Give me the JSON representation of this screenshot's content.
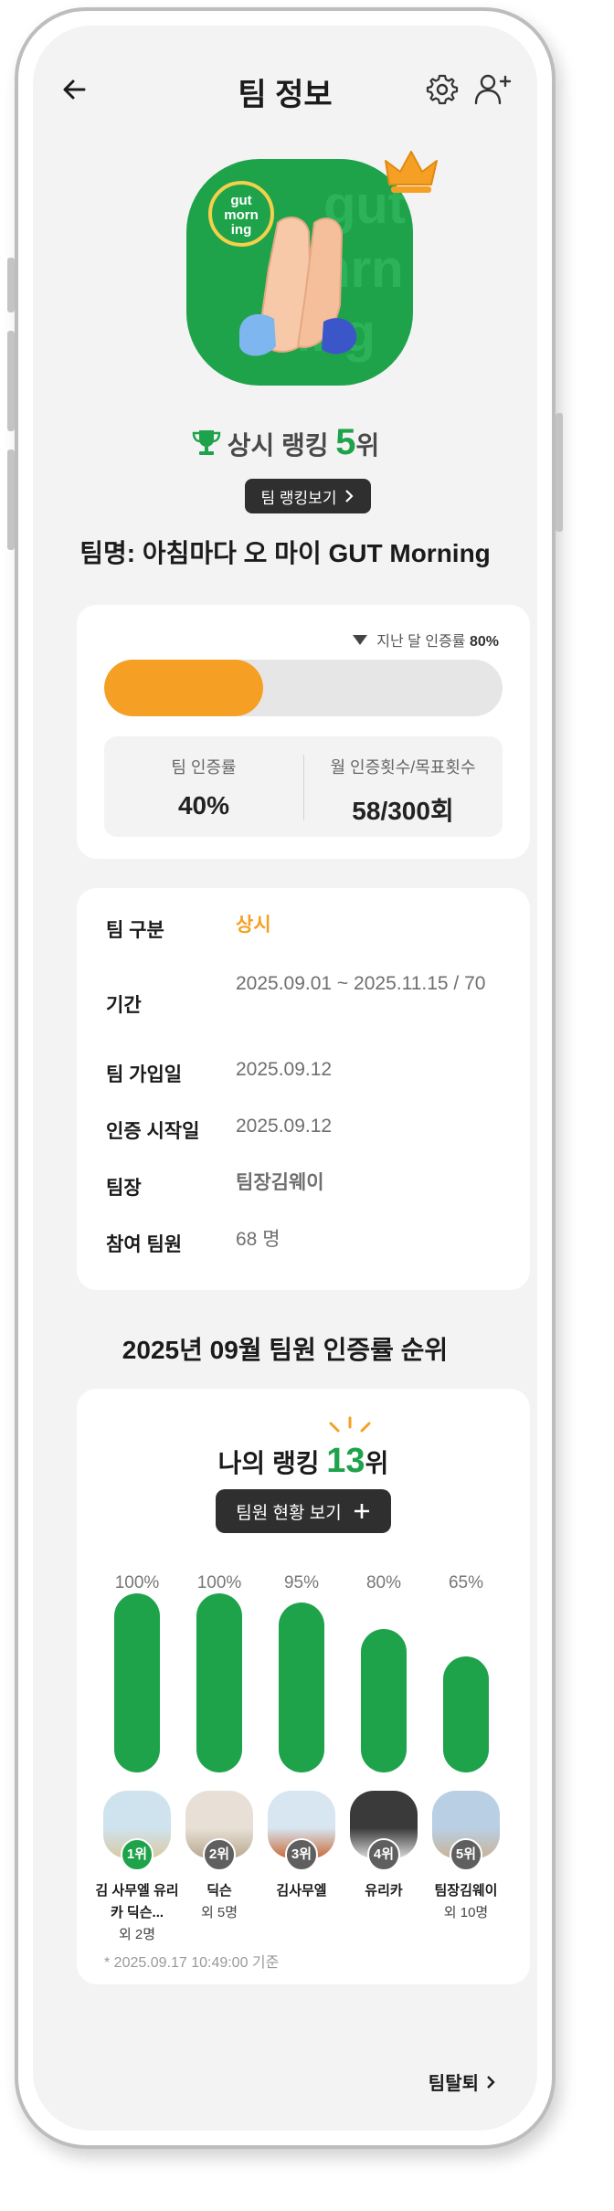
{
  "header": {
    "title": "팀 정보",
    "back_icon": "back-arrow-icon",
    "settings_icon": "gear-icon",
    "add_member_icon": "add-user-icon"
  },
  "team": {
    "logo_text": "gut morn ing",
    "ranking_prefix": "상시 랭킹",
    "ranking_value": "5",
    "ranking_suffix": "위",
    "ranking_button": "팀 랭킹보기",
    "name": "팀명: 아침마다 오 마이 GUT Morning"
  },
  "progress": {
    "last_month_label": "지난 달 인증률",
    "last_month_value": "80%",
    "fill_fraction": 0.4,
    "rate_label": "팀 인증률",
    "rate_value": "40%",
    "count_label": "월 인증횟수/목표횟수",
    "count_value": "58/300회"
  },
  "info": {
    "rows": [
      {
        "key": "팀 구분",
        "value": "상시"
      },
      {
        "key": "기간",
        "value": "2025.09.01 ~ 2025.11.15 / 70"
      },
      {
        "key": "팀 가입일",
        "value": "2025.09.12"
      },
      {
        "key": "인증 시작일",
        "value": "2025.09.12"
      },
      {
        "key": "팀장",
        "value": "팀장김웨이"
      },
      {
        "key": "참여 팀원",
        "value": "68 명"
      }
    ]
  },
  "ranking_section": {
    "title": "2025년 09월 팀원 인증률 순위",
    "my_rank_prefix": "나의 랭킹",
    "my_rank_value": "13",
    "my_rank_suffix": "위",
    "member_button": "팀원 현황 보기",
    "timestamp": "* 2025.09.17 10:49:00 기준"
  },
  "chart_data": {
    "type": "bar",
    "categories": [
      "1위",
      "2위",
      "3위",
      "4위",
      "5위"
    ],
    "values": [
      100,
      100,
      95,
      80,
      65
    ],
    "value_labels": [
      "100%",
      "100%",
      "95%",
      "80%",
      "65%"
    ],
    "ylim": [
      0,
      100
    ],
    "members": [
      {
        "rank": "1위",
        "name": "김 사무엘 유리카 딕슨...",
        "sub": "외 2명",
        "badge_color": "#1ea34b"
      },
      {
        "rank": "2위",
        "name": "딕슨",
        "sub": "외 5명",
        "badge_color": "#5f5f5f"
      },
      {
        "rank": "3위",
        "name": "김사무엘",
        "sub": "",
        "badge_color": "#5f5f5f"
      },
      {
        "rank": "4위",
        "name": "유리카",
        "sub": "",
        "badge_color": "#5f5f5f"
      },
      {
        "rank": "5위",
        "name": "팀장김웨이",
        "sub": "외 10명",
        "badge_color": "#5f5f5f"
      }
    ]
  },
  "footer": {
    "leave_label": "팀탈퇴"
  },
  "colors": {
    "green": "#1ea34b",
    "orange": "#f5a024",
    "dark_button": "#2f2f2f"
  }
}
